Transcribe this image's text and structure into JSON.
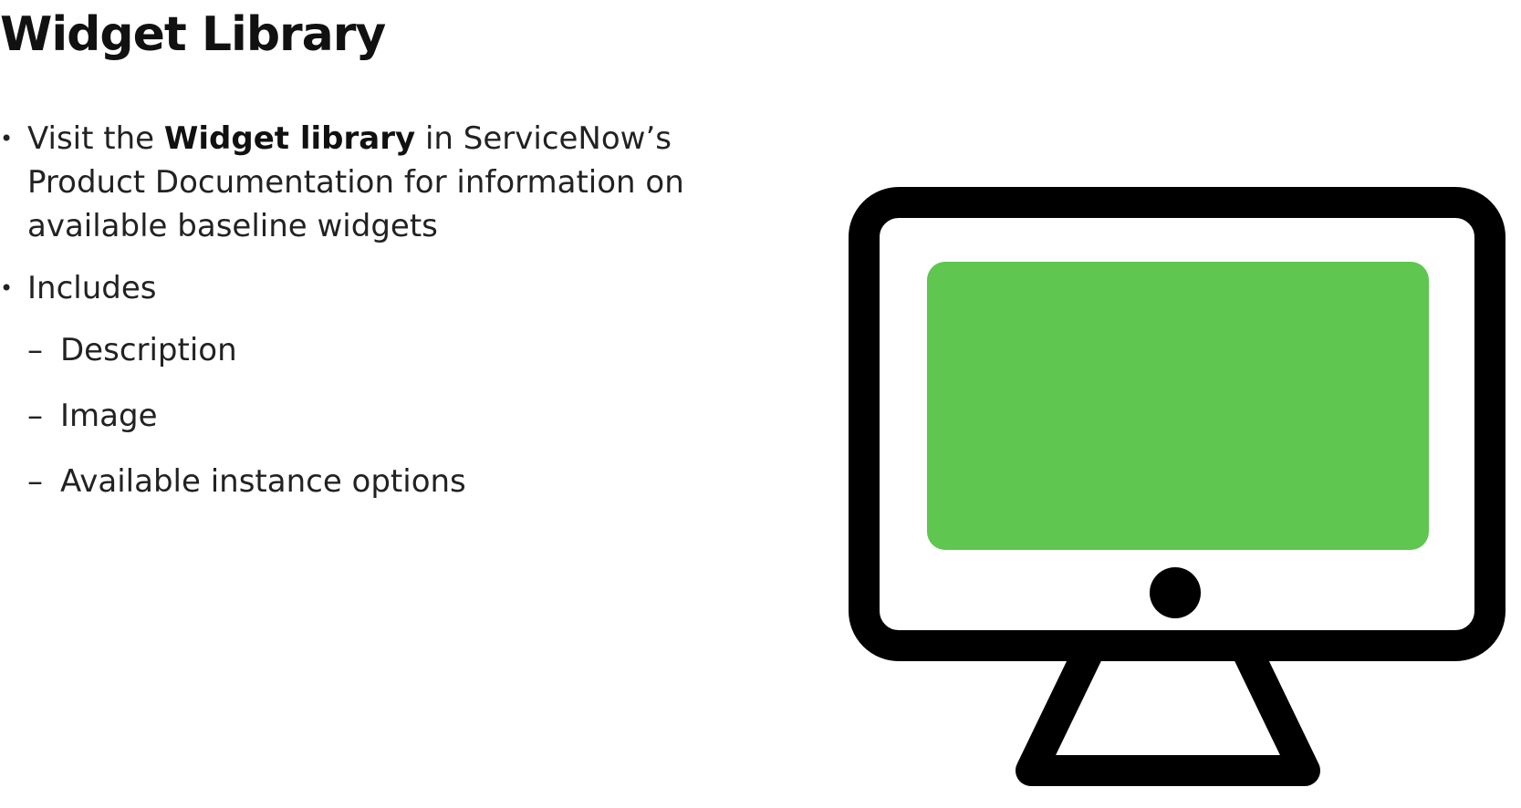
{
  "slide": {
    "title": "Widget Library",
    "bullets": [
      {
        "prefix": "Visit the ",
        "bold": "Widget library",
        "suffix": " in ServiceNow’s Product Documentation for information on available baseline widgets"
      },
      {
        "text": "Includes",
        "sub_items": [
          "Description",
          "Image",
          "Available instance options"
        ]
      }
    ],
    "bullet_glyph": "•",
    "dash_glyph": "–"
  },
  "illustration": {
    "icon": "monitor-icon",
    "frame_color": "#000000",
    "screen_color": "#5fc650",
    "background": "#ffffff"
  }
}
